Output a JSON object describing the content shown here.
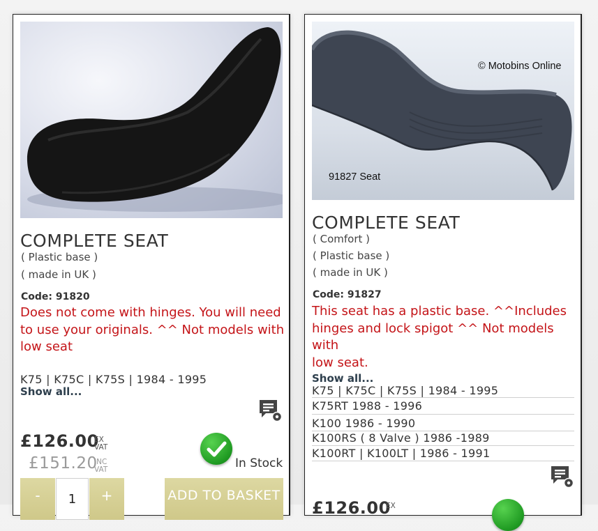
{
  "products": [
    {
      "title": "COMPLETE SEAT",
      "descriptors": [
        "( Plastic base )",
        "( made in UK )"
      ],
      "code": "Code: 91820",
      "note": [
        "Does not come with hinges. You will need",
        "to use your originals. ^^ Not models with",
        "low seat"
      ],
      "models": [
        "K75 | K75C | K75S | 1984 - 1995"
      ],
      "show_all": "Show all...",
      "price_ex": "£126.00",
      "price_inc": "£151.20",
      "ex_vat": [
        "EX",
        "VAT"
      ],
      "inc_vat": [
        "INC",
        "VAT"
      ],
      "stock": "In Stock",
      "qty_value": "1",
      "minus_label": "-",
      "plus_label": "+",
      "add_label": "ADD TO BASKET"
    },
    {
      "title": "COMPLETE SEAT",
      "descriptors": [
        "( Comfort )",
        "( Plastic base )",
        "( made in UK )"
      ],
      "code": "Code: 91827",
      "note": [
        "This seat has a plastic base. ^^Includes",
        "hinges and lock spigot ^^ Not models with",
        "low seat."
      ],
      "show_all": "Show all...",
      "models": [
        "K75 | K75C | K75S | 1984 - 1995",
        "K75RT 1988 - 1996",
        "K100 1986 - 1990",
        "K100RS ( 8 Valve ) 1986 -1989",
        "K100RT | K100LT | 1986 - 1991"
      ],
      "photo_caption": "91827 Seat",
      "photo_watermark": "© Motobins Online",
      "price_ex_partial": "£126.00",
      "ex_vat_partial": "EX"
    }
  ],
  "colors": {
    "note_red": "#c41418",
    "button_olive": "#d6cf96",
    "stock_green": "#2fb52f"
  }
}
